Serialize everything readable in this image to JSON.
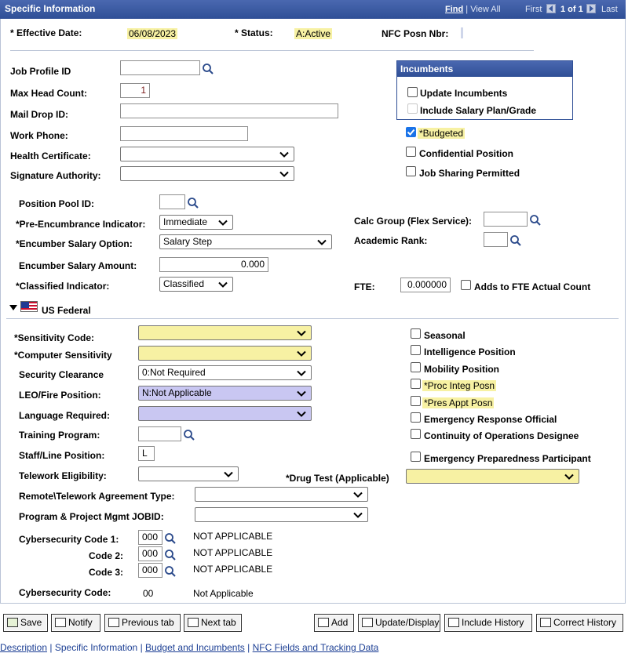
{
  "header": {
    "title": "Specific Information",
    "find": "Find",
    "separator": "|",
    "view_all": "View All",
    "first": "First",
    "count": "1 of 1",
    "last": "Last"
  },
  "top": {
    "effective_date_label": "* Effective Date:",
    "effective_date": "06/08/2023",
    "status_label": "* Status:",
    "status": "A:Active",
    "nfc_label": "NFC Posn Nbr:",
    "nfc_value": ""
  },
  "left": {
    "job_profile_label": "Job Profile ID",
    "job_profile": "",
    "max_head_label": "Max Head Count:",
    "max_head": "1",
    "mail_drop_label": "Mail Drop ID:",
    "mail_drop": "",
    "work_phone_label": "Work Phone:",
    "work_phone": "",
    "health_cert_label": "Health Certificate:",
    "health_cert": "",
    "sig_auth_label": "Signature Authority:",
    "sig_auth": ""
  },
  "incumbents": {
    "title": "Incumbents",
    "update": "Update Incumbents",
    "include_salary": "Include Salary Plan/Grade"
  },
  "flags": {
    "budgeted": "*Budgeted",
    "confidential": "Confidential Position",
    "job_sharing": "Job Sharing Permitted"
  },
  "mid": {
    "pool_label": "Position Pool ID:",
    "pool": "",
    "pre_enc_label": "*Pre-Encumbrance Indicator:",
    "pre_enc": "Immediate",
    "enc_sal_opt_label": "*Encumber Salary Option:",
    "enc_sal_opt": "Salary Step",
    "enc_sal_amt_label": "Encumber Salary Amount:",
    "enc_sal_amt": "0.000",
    "classified_label": "*Classified Indicator:",
    "classified": "Classified",
    "calc_group_label": "Calc Group (Flex Service):",
    "calc_group": "",
    "academic_label": "Academic Rank:",
    "academic": "",
    "fte_label": "FTE:",
    "fte": "0.000000",
    "adds_fte": "Adds to FTE Actual Count"
  },
  "federal": {
    "section_label": "US Federal",
    "sensitivity_label": "*Sensitivity Code:",
    "sensitivity": "",
    "computer_label": "*Computer Sensitivity",
    "computer": "",
    "security_label": "Security Clearance",
    "security": "0:Not Required",
    "leo_label": "LEO/Fire Position:",
    "leo": "N:Not Applicable",
    "language_label": "Language Required:",
    "language": "",
    "training_label": "Training Program:",
    "training": "",
    "staff_label": "Staff/Line Position:",
    "staff": "L",
    "telework_label": "Telework Eligibility:",
    "telework": "",
    "drug_label": "*Drug Test (Applicable)",
    "drug": "",
    "remote_label": "Remote\\Telework Agreement Type:",
    "remote": "",
    "ppm_label": "Program & Project Mgmt JOBID:",
    "ppm": "",
    "cyber1_label": "Cybersecurity Code 1:",
    "cyber1": "000",
    "cyber1_desc": "NOT APPLICABLE",
    "cyber2_label": "Code 2:",
    "cyber2": "000",
    "cyber2_desc": "NOT APPLICABLE",
    "cyber3_label": "Code 3:",
    "cyber3": "000",
    "cyber3_desc": "NOT APPLICABLE",
    "cyber_code_label": "Cybersecurity Code:",
    "cyber_code": "00",
    "cyber_code_desc": "Not Applicable",
    "seasonal": "Seasonal",
    "intelligence": "Intelligence Position",
    "mobility": "Mobility Position",
    "proc_integ": "*Proc Integ Posn",
    "pres_appt": "*Pres Appt Posn",
    "emergency_resp": "Emergency Response Official",
    "continuity": "Continuity of Operations Designee",
    "emergency_prep": "Emergency Preparedness Participant"
  },
  "buttons": {
    "save": "Save",
    "notify": "Notify",
    "prev_tab": "Previous tab",
    "next_tab": "Next tab",
    "add": "Add",
    "update_display": "Update/Display",
    "include_history": "Include History",
    "correct_history": "Correct History"
  },
  "links": {
    "description": "Description",
    "specific": "Specific Information",
    "budget": "Budget and Incumbents",
    "nfc": "NFC Fields and Tracking Data",
    "sep": "|"
  },
  "colors": {
    "header": "#3c5aa0",
    "required_fill": "#f7f1a3",
    "lookup_fill": "#c9c7f2",
    "link": "#1c3f94"
  }
}
